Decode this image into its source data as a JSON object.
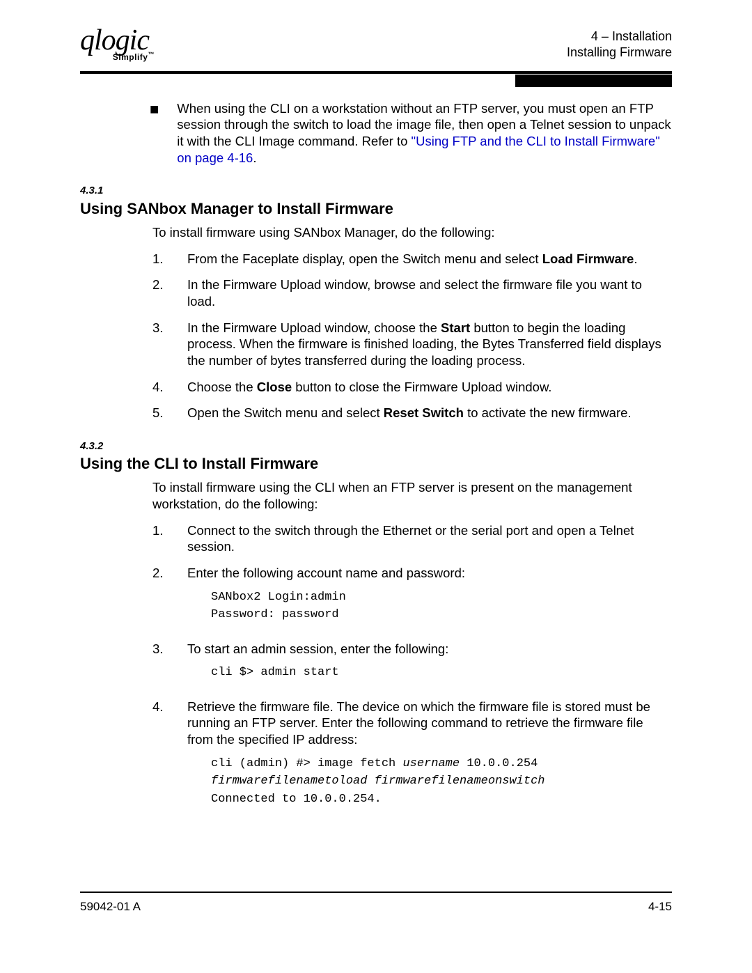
{
  "header": {
    "logo_main": "qlogic",
    "logo_sub": "Simplify",
    "chapter": "4 – Installation",
    "section": "Installing Firmware"
  },
  "bullet1": {
    "text_part1": "When using the CLI on a workstation without an FTP server, you must open an FTP session through the switch to load the image file, then open a Telnet session to unpack it with the CLI Image command. Refer to ",
    "link": "\"Using FTP and the CLI to Install Firmware\" on page 4-16",
    "text_part2": "."
  },
  "sec431": {
    "num": "4.3.1",
    "title": "Using SANbox Manager to Install Firmware",
    "intro": "To install firmware using SANbox Manager, do the following:",
    "step1_a": "From the Faceplate display, open the Switch menu and select ",
    "step1_b": "Load Firmware",
    "step1_c": ".",
    "step2": "In the Firmware Upload window, browse and select the firmware file you want to load.",
    "step3_a": "In the Firmware Upload window, choose the ",
    "step3_b": "Start",
    "step3_c": " button to begin the loading process. When the firmware is finished loading, the Bytes Transferred field displays the number of bytes transferred during the loading process.",
    "step4_a": "Choose the ",
    "step4_b": "Close",
    "step4_c": " button to close the Firmware Upload window.",
    "step5_a": "Open the Switch menu and select ",
    "step5_b": "Reset Switch",
    "step5_c": " to activate the new firmware."
  },
  "sec432": {
    "num": "4.3.2",
    "title": "Using the CLI to Install Firmware",
    "intro": "To install firmware using the CLI when an FTP server is present on the management workstation, do the following:",
    "step1": "Connect to the switch through the Ethernet or the serial port and open a Telnet session.",
    "step2": "Enter the following account name and password:",
    "code2": "SANbox2 Login:admin\nPassword: password",
    "step3": "To start an admin session, enter the following:",
    "code3": "cli $> admin start",
    "step4": "Retrieve the firmware file. The device on which the firmware file is stored must be running an FTP server. Enter the following command to retrieve the firmware file from the specified IP address:",
    "code4_line1_a": "cli (admin) #> image fetch ",
    "code4_line1_b": "username",
    "code4_line1_c": " 10.0.0.254",
    "code4_line2": "firmwarefilenametoload firmwarefilenameonswitch",
    "code4_line3": "Connected to 10.0.0.254."
  },
  "footer": {
    "left": "59042-01 A",
    "right": "4-15"
  }
}
